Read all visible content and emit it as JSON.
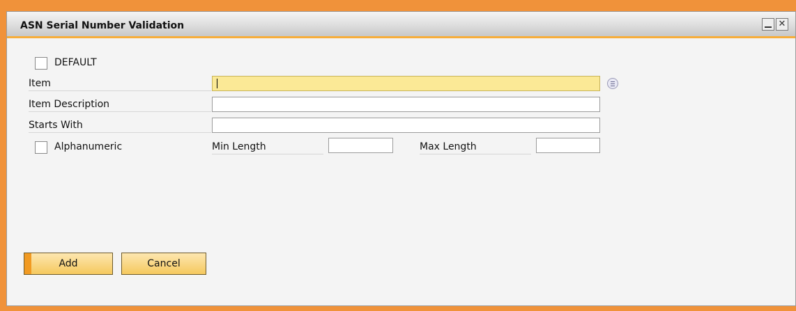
{
  "window": {
    "title": "ASN Serial Number Validation",
    "minimize_label": "",
    "close_label": "✕"
  },
  "form": {
    "default_checkbox": {
      "label": "DEFAULT",
      "checked": false
    },
    "item": {
      "label": "Item",
      "value": ""
    },
    "item_description": {
      "label": "Item Description",
      "value": ""
    },
    "starts_with": {
      "label": "Starts With",
      "value": ""
    },
    "alphanumeric_checkbox": {
      "label": "Alphanumeric",
      "checked": false
    },
    "min_length": {
      "label": "Min Length",
      "value": ""
    },
    "max_length": {
      "label": "Max Length",
      "value": ""
    }
  },
  "buttons": {
    "add_label": "Add",
    "cancel_label": "Cancel"
  },
  "colors": {
    "frame": "#f0923a",
    "active_field": "#fbe996",
    "button_fill": "#f5c95e",
    "button_accent": "#f19a22"
  }
}
